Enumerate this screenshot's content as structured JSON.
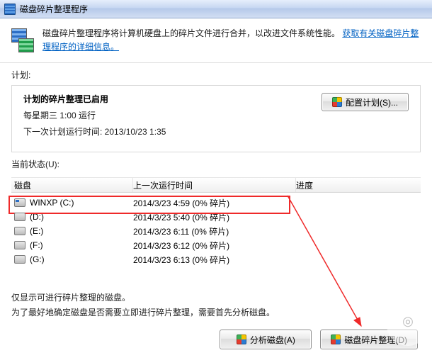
{
  "window": {
    "title": "磁盘碎片整理程序"
  },
  "header": {
    "description_lead": "磁盘碎片整理程序将计算机硬盘上的碎片文件进行合并，以改进文件系统性能。",
    "link_text": "获取有关磁盘碎片整理程序的详细信息。"
  },
  "schedule": {
    "label": "计划:",
    "status_title": "计划的碎片整理已启用",
    "line1": "每星期三  1:00 运行",
    "line2": "下一次计划运行时间: 2013/10/23 1:35",
    "configure_button": "配置计划(S)..."
  },
  "status": {
    "label": "当前状态(U):",
    "col_disk": "磁盘",
    "col_last": "上一次运行时间",
    "col_progress": "进度",
    "drives": [
      {
        "name": "WINXP (C:)",
        "last": "2014/3/23 4:59 (0% 碎片)",
        "win": true
      },
      {
        "name": "(D:)",
        "last": "2014/3/23 5:40 (0% 碎片)",
        "win": false
      },
      {
        "name": "(E:)",
        "last": "2014/3/23 6:11 (0% 碎片)",
        "win": false
      },
      {
        "name": "(F:)",
        "last": "2014/3/23 6:12 (0% 碎片)",
        "win": false
      },
      {
        "name": "(G:)",
        "last": "2014/3/23 6:13 (0% 碎片)",
        "win": false
      }
    ]
  },
  "notes": {
    "line1": "仅显示可进行碎片整理的磁盘。",
    "line2": "为了最好地确定磁盘是否需要立即进行碎片整理，需要首先分析磁盘。"
  },
  "buttons": {
    "analyze": "分析磁盘(A)",
    "defrag": "磁盘碎片整理(D)"
  },
  "watermark": {
    "line1": " "
  }
}
